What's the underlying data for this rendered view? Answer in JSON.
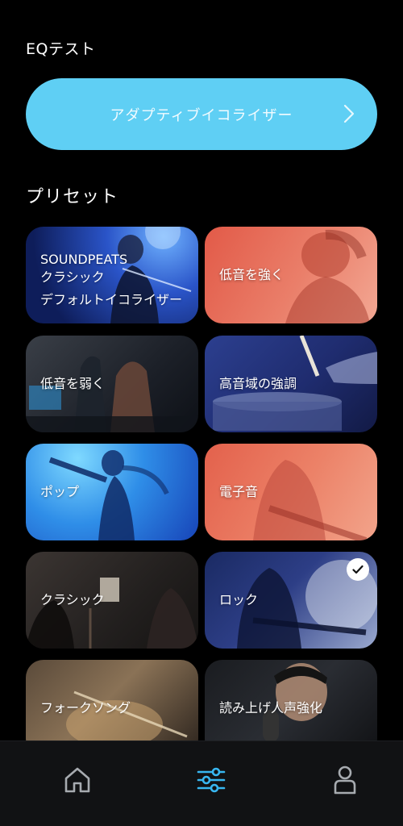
{
  "eq_test": {
    "title": "EQテスト"
  },
  "adaptive": {
    "label": "アダプティブイコライザー",
    "icon": "chevron-right-icon"
  },
  "presets": {
    "title": "プリセット",
    "items": [
      {
        "line1": "SOUNDPEATS",
        "line2": "クラシック",
        "line3": "デフォルトイコライザー",
        "selected": false
      },
      {
        "label": "低音を強く",
        "selected": false
      },
      {
        "label": "低音を弱く",
        "selected": false
      },
      {
        "label": "高音域の強調",
        "selected": false
      },
      {
        "label": "ポップ",
        "selected": false
      },
      {
        "label": "電子音",
        "selected": false
      },
      {
        "label": "クラシック",
        "selected": false
      },
      {
        "label": "ロック",
        "selected": true
      },
      {
        "label": "フォークソング",
        "selected": false
      },
      {
        "label": "読み上げ人声強化",
        "selected": false
      }
    ]
  },
  "bottom_nav": {
    "items": [
      {
        "icon": "home-icon",
        "active": false
      },
      {
        "icon": "equalizer-sliders-icon",
        "active": true
      },
      {
        "icon": "profile-icon",
        "active": false
      }
    ]
  },
  "colors": {
    "accent": "#5fcff4",
    "nav_active": "#38b6f0",
    "nav_inactive": "#a7abb0",
    "background": "#000000"
  }
}
